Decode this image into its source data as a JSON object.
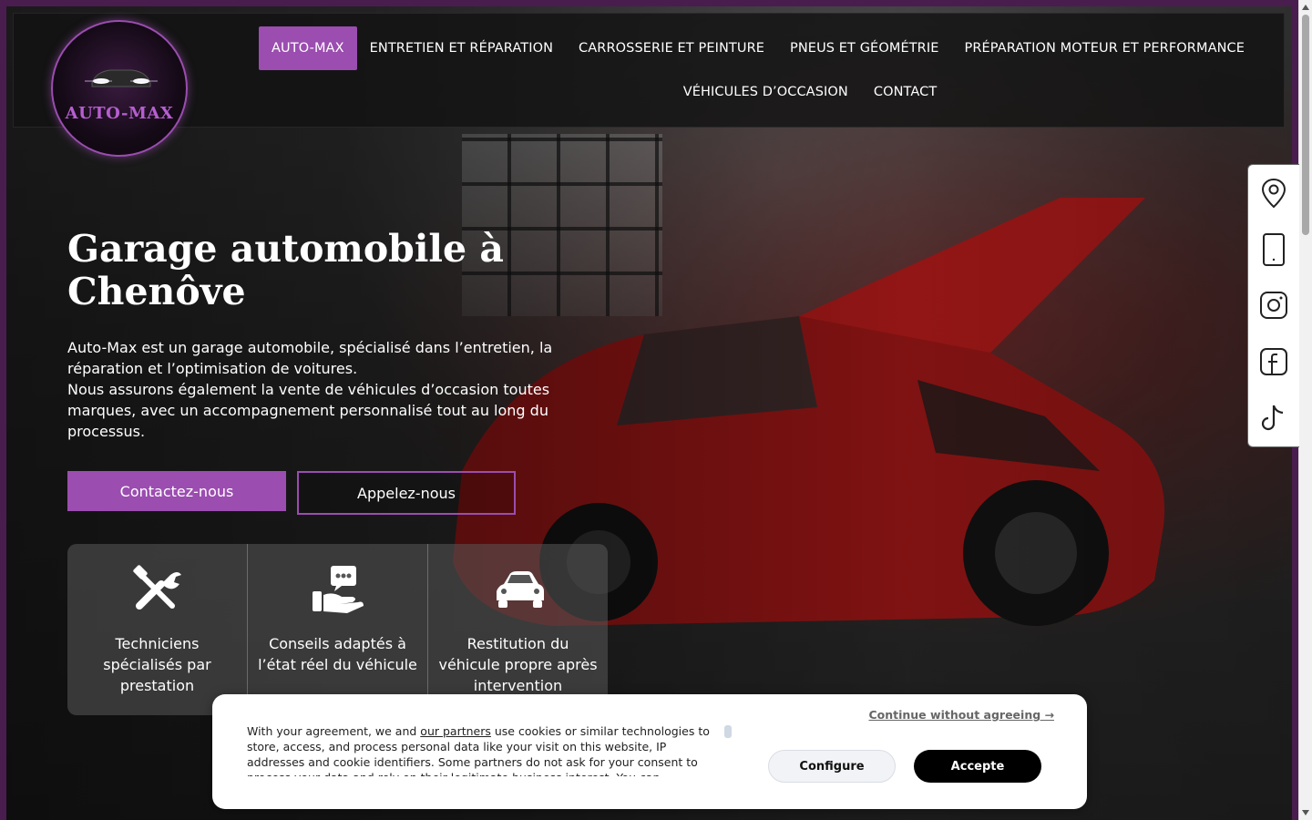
{
  "brand": {
    "logo_text": "AUTO-MAX",
    "accent": "#9b4db0"
  },
  "nav": {
    "items": [
      {
        "label": "AUTO-MAX",
        "active": true
      },
      {
        "label": "ENTRETIEN ET RÉPARATION"
      },
      {
        "label": "CARROSSERIE ET PEINTURE"
      },
      {
        "label": "PNEUS ET GÉOMÉTRIE"
      },
      {
        "label": "PRÉPARATION MOTEUR ET PERFORMANCE"
      },
      {
        "label": "VÉHICULES D’OCCASION"
      },
      {
        "label": "CONTACT"
      }
    ]
  },
  "side_icons": [
    "map-pin-icon",
    "phone-icon",
    "instagram-icon",
    "facebook-icon",
    "tiktok-icon"
  ],
  "hero": {
    "title_line1": "Garage automobile à",
    "title_line2": "Chenôve",
    "paragraph1": "Auto-Max est un garage automobile, spécialisé dans l’entretien, la réparation et l’optimisation de voitures.",
    "paragraph2": "Nous assurons également la vente de véhicules d’occasion toutes marques, avec un accompagnement personnalisé tout au long du processus.",
    "btn_contact": "Contactez-nous",
    "btn_call": "Appelez-nous"
  },
  "features": [
    {
      "icon": "tools-icon",
      "label": "Techniciens spécialisés par prestation"
    },
    {
      "icon": "advice-hand-icon",
      "label": "Conseils adaptés à l’état réel du véhicule"
    },
    {
      "icon": "car-icon",
      "label": "Restitution du véhicule propre après intervention"
    }
  ],
  "cookie": {
    "continue_link": "Continue without agreeing →",
    "text_before_link": "With your agreement, we and ",
    "link_text": "our partners",
    "text_after_link": " use cookies or similar technologies to store, access, and process personal data like your visit on this website, IP addresses and cookie identifiers. Some partners do not ask for your consent to process your data and rely on their legitimate business interest. You can",
    "configure_label": "Configure",
    "accept_label": "Accepte"
  }
}
